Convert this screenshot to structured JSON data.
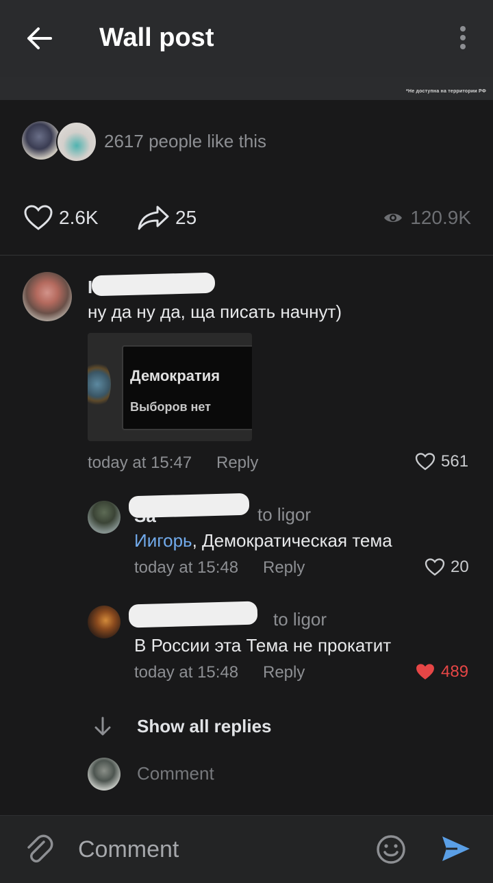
{
  "header": {
    "title": "Wall post"
  },
  "notice": {
    "text": "*Не доступна на территории РФ"
  },
  "post": {
    "likes_summary": "2617 people like this",
    "like_count": "2.6K",
    "share_count": "25",
    "view_count": "120.9K"
  },
  "comments": [
    {
      "text": "ну да ну да, ща писать начнут)",
      "attachment": {
        "line1": "Демократия",
        "line2": "Выборов нет"
      },
      "time": "today at 15:47",
      "reply_label": "Reply",
      "likes": "561"
    }
  ],
  "replies": [
    {
      "to": "to ligor",
      "mention": "Иигорь",
      "text": ", Демократическая тема",
      "time": "today at 15:48",
      "reply_label": "Reply",
      "likes": "20",
      "liked": false
    },
    {
      "to": "to ligor",
      "text": "В России эта Тема не прокатит",
      "time": "today at 15:48",
      "reply_label": "Reply",
      "likes": "489",
      "liked": true
    }
  ],
  "show_all_replies": "Show all replies",
  "inline_comment_placeholder": "Comment",
  "bottom_bar": {
    "placeholder": "Comment"
  },
  "colors": {
    "background": "#19191a",
    "link": "#71aaeb",
    "liked": "#e64646",
    "send": "#5a9fe6"
  }
}
